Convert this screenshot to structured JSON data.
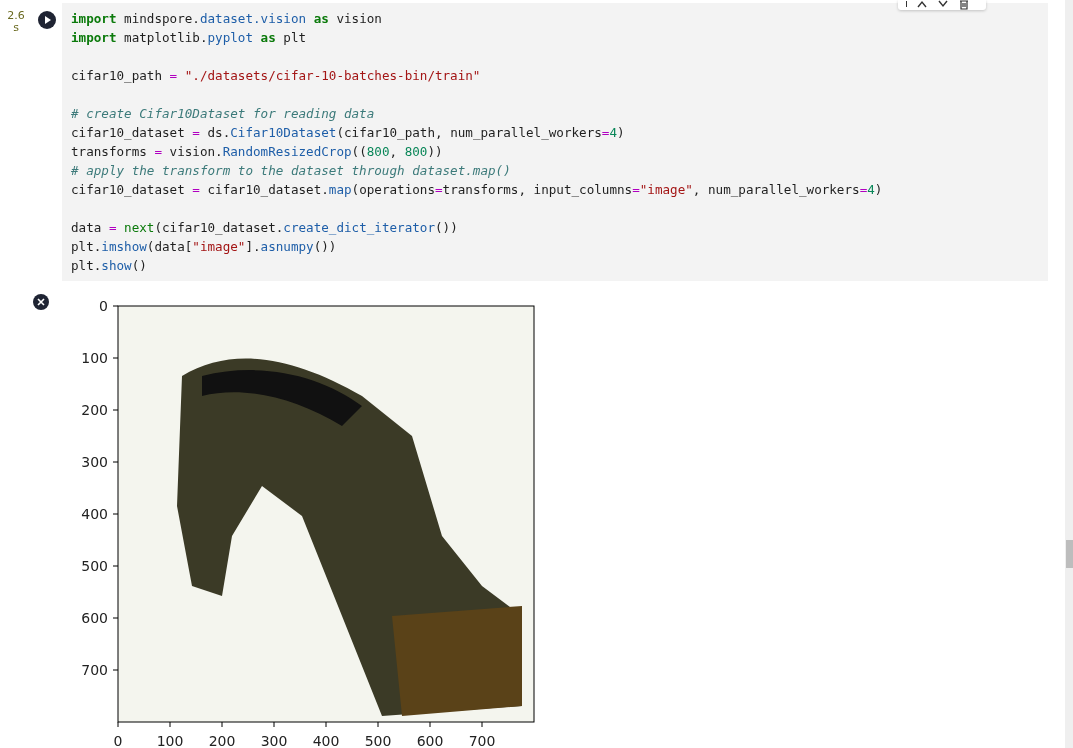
{
  "cell": {
    "exec_time": "2.6 s",
    "lines": [
      {
        "kind": "code",
        "tokens": [
          {
            "kind": "kw",
            "s": "import"
          },
          {
            "kind": "txt",
            "s": " mindspore."
          },
          {
            "kind": "mod",
            "s": "dataset.vision "
          },
          {
            "kind": "kw",
            "s": "as"
          },
          {
            "kind": "txt",
            "s": " vision"
          }
        ]
      },
      {
        "kind": "code",
        "tokens": [
          {
            "kind": "kw",
            "s": "import"
          },
          {
            "kind": "txt",
            "s": " matplotlib."
          },
          {
            "kind": "mod",
            "s": "pyplot "
          },
          {
            "kind": "kw",
            "s": "as"
          },
          {
            "kind": "txt",
            "s": " plt"
          }
        ]
      },
      {
        "kind": "blank"
      },
      {
        "kind": "code",
        "tokens": [
          {
            "kind": "txt",
            "s": "cifar10_path "
          },
          {
            "kind": "op",
            "s": "= "
          },
          {
            "kind": "str",
            "s": "\"./datasets/cifar-10-batches-bin/train\""
          }
        ]
      },
      {
        "kind": "blank"
      },
      {
        "kind": "code",
        "tokens": [
          {
            "kind": "com",
            "s": "# create Cifar10Dataset for reading data"
          }
        ]
      },
      {
        "kind": "code",
        "tokens": [
          {
            "kind": "txt",
            "s": "cifar10_dataset "
          },
          {
            "kind": "op",
            "s": "="
          },
          {
            "kind": "txt",
            "s": " ds."
          },
          {
            "kind": "mod",
            "s": "Cifar10Dataset"
          },
          {
            "kind": "txt",
            "s": "(cifar10_path, num_parallel_workers"
          },
          {
            "kind": "op",
            "s": "="
          },
          {
            "kind": "num",
            "s": "4"
          },
          {
            "kind": "txt",
            "s": ")"
          }
        ]
      },
      {
        "kind": "code",
        "tokens": [
          {
            "kind": "txt",
            "s": "transforms "
          },
          {
            "kind": "op",
            "s": "="
          },
          {
            "kind": "txt",
            "s": " vision."
          },
          {
            "kind": "mod",
            "s": "RandomResizedCrop"
          },
          {
            "kind": "txt",
            "s": "(("
          },
          {
            "kind": "num",
            "s": "800"
          },
          {
            "kind": "txt",
            "s": ", "
          },
          {
            "kind": "num",
            "s": "800"
          },
          {
            "kind": "txt",
            "s": "))"
          }
        ]
      },
      {
        "kind": "code",
        "tokens": [
          {
            "kind": "com",
            "s": "# apply the transform to the dataset through dataset.map()"
          }
        ]
      },
      {
        "kind": "code",
        "tokens": [
          {
            "kind": "txt",
            "s": "cifar10_dataset "
          },
          {
            "kind": "op",
            "s": "="
          },
          {
            "kind": "txt",
            "s": " cifar10_dataset."
          },
          {
            "kind": "mod",
            "s": "map"
          },
          {
            "kind": "txt",
            "s": "(operations"
          },
          {
            "kind": "op",
            "s": "="
          },
          {
            "kind": "txt",
            "s": "transforms, input_columns"
          },
          {
            "kind": "op",
            "s": "="
          },
          {
            "kind": "str",
            "s": "\"image\""
          },
          {
            "kind": "txt",
            "s": ", num_parallel_workers"
          },
          {
            "kind": "op",
            "s": "="
          },
          {
            "kind": "num",
            "s": "4"
          },
          {
            "kind": "txt",
            "s": ")"
          }
        ]
      },
      {
        "kind": "blank"
      },
      {
        "kind": "code",
        "tokens": [
          {
            "kind": "txt",
            "s": "data "
          },
          {
            "kind": "op",
            "s": "= "
          },
          {
            "kind": "fn",
            "s": "next"
          },
          {
            "kind": "txt",
            "s": "(cifar10_dataset."
          },
          {
            "kind": "mod",
            "s": "create_dict_iterator"
          },
          {
            "kind": "txt",
            "s": "())"
          }
        ]
      },
      {
        "kind": "code",
        "tokens": [
          {
            "kind": "txt",
            "s": "plt."
          },
          {
            "kind": "mod",
            "s": "imshow"
          },
          {
            "kind": "txt",
            "s": "(data["
          },
          {
            "kind": "str",
            "s": "\"image\""
          },
          {
            "kind": "txt",
            "s": "]."
          },
          {
            "kind": "mod",
            "s": "asnumpy"
          },
          {
            "kind": "txt",
            "s": "())"
          }
        ]
      },
      {
        "kind": "code",
        "tokens": [
          {
            "kind": "txt",
            "s": "plt."
          },
          {
            "kind": "mod",
            "s": "show"
          },
          {
            "kind": "txt",
            "s": "()"
          }
        ]
      }
    ]
  },
  "output": {
    "plot": {
      "xticks": [
        "0",
        "100",
        "200",
        "300",
        "400",
        "500",
        "600",
        "700"
      ],
      "yticks": [
        "0",
        "100",
        "200",
        "300",
        "400",
        "500",
        "600",
        "700"
      ]
    }
  }
}
